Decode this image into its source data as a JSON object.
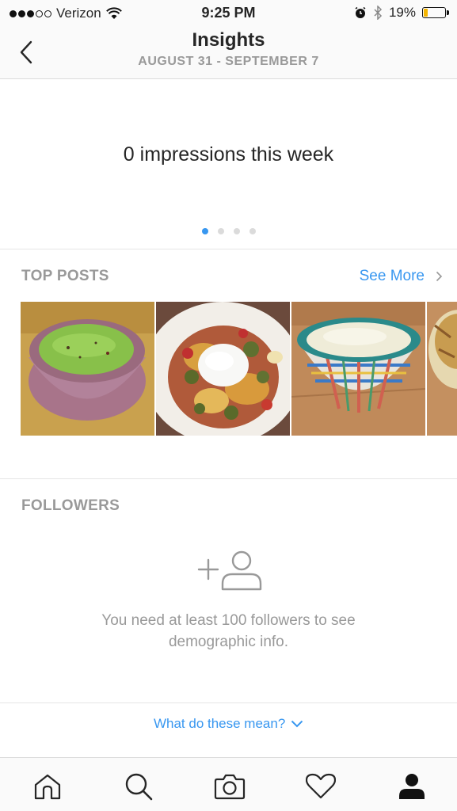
{
  "status_bar": {
    "carrier": "Verizon",
    "time": "9:25 PM",
    "battery_percent": "19%",
    "battery_level": 0.19,
    "battery_color": "#f4b400",
    "icons": [
      "signal-dots-icon",
      "wifi-icon",
      "alarm-icon",
      "bluetooth-icon",
      "battery-icon"
    ]
  },
  "header": {
    "title": "Insights",
    "date_range": "AUGUST 31 - SEPTEMBER 7",
    "back_icon": "chevron-left-icon"
  },
  "impressions": {
    "text": "0 impressions this week",
    "pager_pages": 4,
    "pager_active_index": 0,
    "accent": "#3897f0"
  },
  "top_posts": {
    "title": "TOP POSTS",
    "see_more": "See More",
    "posts": [
      {
        "description": "green soup in mauve bowl"
      },
      {
        "description": "nachos with sour cream"
      },
      {
        "description": "creamy soup in plaid bowl"
      },
      {
        "description": "soup bowl partially visible"
      }
    ]
  },
  "followers": {
    "title": "FOLLOWERS",
    "message": "You need at least 100 followers to see demographic info.",
    "icon": "add-person-icon"
  },
  "footer_link": {
    "label": "What do these mean?",
    "icon": "chevron-down-icon"
  },
  "tab_bar": {
    "items": [
      "home-icon",
      "search-icon",
      "camera-icon",
      "heart-icon",
      "profile-icon"
    ],
    "active": "profile-icon"
  }
}
